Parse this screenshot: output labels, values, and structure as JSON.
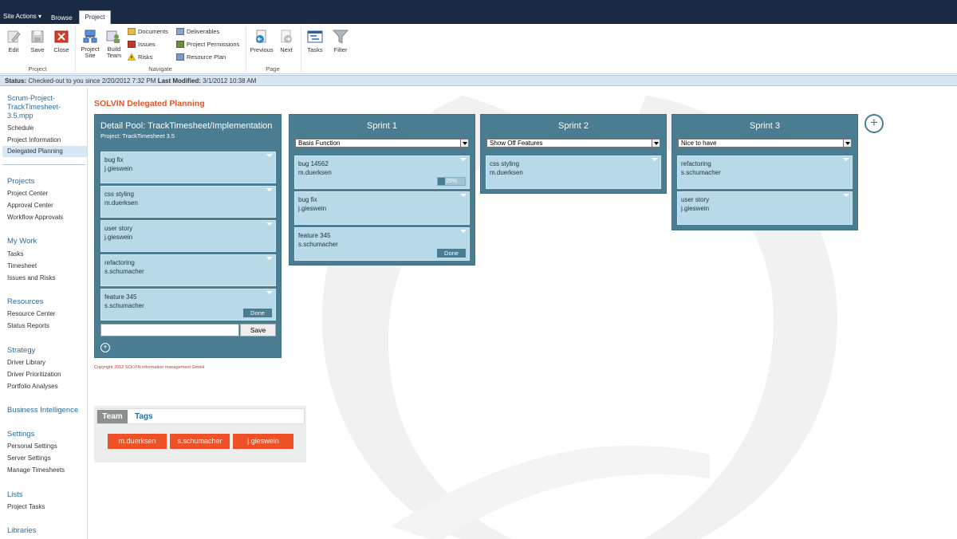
{
  "topbar": {
    "site_actions": "Site Actions",
    "tabs": [
      "Browse",
      "Project"
    ]
  },
  "ribbon": {
    "project_group": {
      "label": "Project",
      "buttons": [
        "Edit",
        "Save",
        "Close"
      ]
    },
    "navigate_group": {
      "label": "Navigate",
      "project_site": "Project Site",
      "build_team": "Build Team",
      "links": [
        "Documents",
        "Issues",
        "Risks",
        "Deliverables",
        "Project Permissions",
        "Resource Plan"
      ]
    },
    "page_group": {
      "label": "Page",
      "buttons": [
        "Previous",
        "Next"
      ]
    },
    "tasks": "Tasks",
    "filter": "Filter"
  },
  "status": {
    "label": "Status:",
    "text": "Checked-out to you since 2/20/2012 7:32 PM",
    "modified_label": "Last Modified:",
    "modified_value": "3/1/2012 10:38 AM"
  },
  "leftnav": {
    "doc_title": "Scrum-Project-TrackTimesheet-3.5.mpp",
    "doc_items": [
      "Schedule",
      "Project Information",
      "Delegated Planning"
    ],
    "sections": [
      {
        "heading": "Projects",
        "items": [
          "Project Center",
          "Approval Center",
          "Workflow Approvals"
        ]
      },
      {
        "heading": "My Work",
        "items": [
          "Tasks",
          "Timesheet",
          "Issues and Risks"
        ]
      },
      {
        "heading": "Resources",
        "items": [
          "Resource Center",
          "Status Reports"
        ]
      },
      {
        "heading": "Strategy",
        "items": [
          "Driver Library",
          "Driver Prioritization",
          "Portfolio Analyses"
        ]
      },
      {
        "heading": "Business Intelligence",
        "items": []
      },
      {
        "heading": "Settings",
        "items": [
          "Personal Settings",
          "Server Settings",
          "Manage Timesheets"
        ]
      },
      {
        "heading": "Lists",
        "items": [
          "Project Tasks"
        ]
      },
      {
        "heading": "Libraries",
        "items": []
      }
    ]
  },
  "main": {
    "title": "SOLVIN Delegated Planning",
    "pool": {
      "title": "Detail Pool: TrackTimesheet/Implementation",
      "subtitle": "Project: TrackTimesheet 3.5",
      "cards": [
        {
          "title": "bug fix",
          "user": "j.gieswein"
        },
        {
          "title": "css styling",
          "user": "m.duerksen"
        },
        {
          "title": "user story",
          "user": "j.gieswein"
        },
        {
          "title": "refactoring",
          "user": "s.schumacher"
        },
        {
          "title": "feature 345",
          "user": "s.schumacher",
          "button": "Done"
        }
      ],
      "input_value": "",
      "save_label": "Save"
    },
    "sprints": [
      {
        "title": "Sprint 1",
        "select": "Basis Function",
        "cards": [
          {
            "title": "bug 14562",
            "user": "m.duerksen",
            "progress_label": "25%",
            "progress": 0.25
          },
          {
            "title": "bug fix",
            "user": "j.gieswein"
          },
          {
            "title": "feature 345",
            "user": "s.schumacher",
            "button": "Done"
          }
        ]
      },
      {
        "title": "Sprint 2",
        "select": "Show Off Features",
        "cards": [
          {
            "title": "css styling",
            "user": "m.duerksen"
          }
        ]
      },
      {
        "title": "Sprint 3",
        "select": "Nice to have",
        "cards": [
          {
            "title": "refactoring",
            "user": "s.schumacher"
          },
          {
            "title": "user story",
            "user": "j.gieswein"
          }
        ]
      }
    ],
    "copyright": "Copyright 2012 SOLVIN information management GmbH"
  },
  "team_panel": {
    "tabs": [
      "Team",
      "Tags"
    ],
    "members": [
      "m.duerksen",
      "s.schumacher",
      "j.gieswein"
    ]
  },
  "colors": {
    "column_bg": "#4a7d91",
    "card_bg": "#b8dae8",
    "accent_orange": "#ee5127",
    "title_orange": "#e0542a",
    "nav_blue": "#2a6c9a",
    "topbar": "#1b2a43"
  }
}
